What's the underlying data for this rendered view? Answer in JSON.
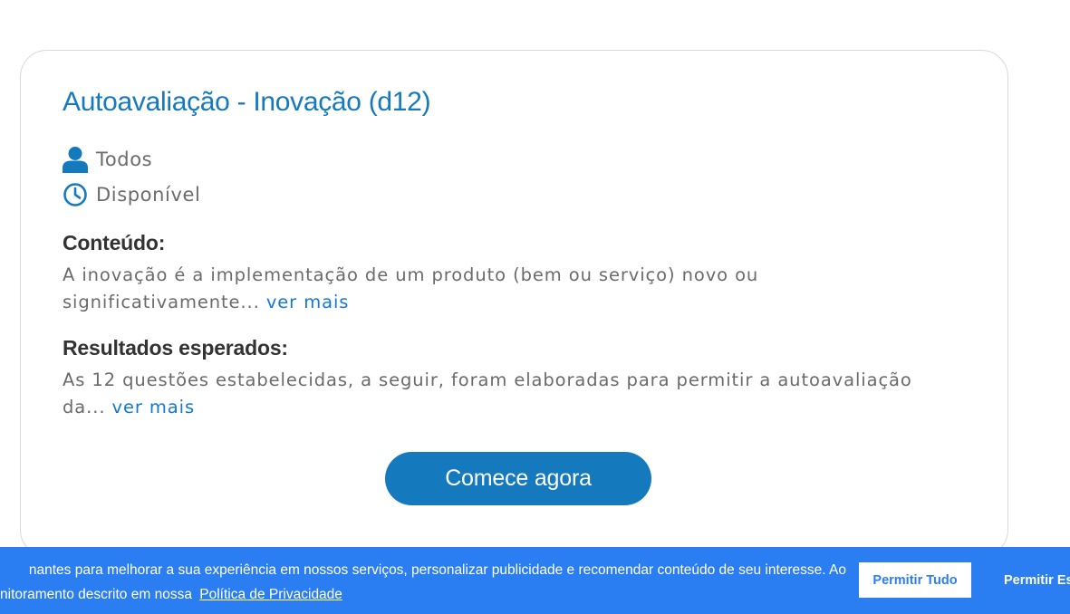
{
  "card": {
    "title": "Autoavaliação - Inovação (d12)",
    "audience": {
      "icon": "user-icon",
      "label": "Todos"
    },
    "status": {
      "icon": "clock-icon",
      "label": "Disponível"
    },
    "content_section": {
      "heading": "Conteúdo:",
      "text_line1": "A inovação é a implementação de um produto (bem ou serviço) novo ou",
      "text_line2": "significativamente...",
      "more_link": "ver mais"
    },
    "results_section": {
      "heading": "Resultados esperados:",
      "text_line1": "As 12 questões estabelecidas, a seguir, foram elaboradas para permitir a autoavaliação",
      "text_line2": "da...",
      "more_link": "ver mais"
    },
    "start_button": "Comece agora"
  },
  "cookie_banner": {
    "text_line1": "nantes para melhorar a sua experiência em nossos serviços, personalizar publicidade e recomendar conteúdo de seu interesse. Ao",
    "text_line2": "nitoramento descrito em nossa",
    "policy_link": "Política de Privacidade",
    "allow_all_button": "Permitir Tudo",
    "allow_essential_button": "Permitir Es"
  },
  "colors": {
    "accent": "#1479bd",
    "link": "#1479d6",
    "banner_background": "#2b7df2",
    "body_text": "#6b6b6b",
    "heading_text": "#333333"
  }
}
